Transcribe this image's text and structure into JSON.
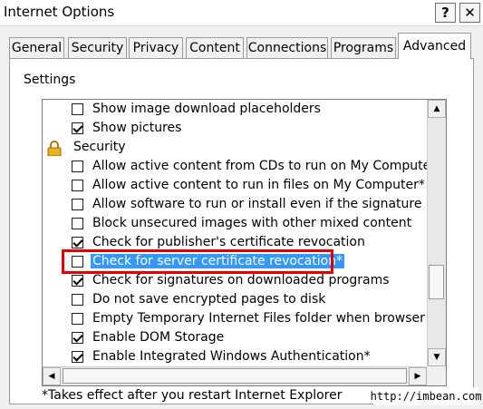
{
  "window": {
    "title": "Internet Options",
    "help_glyph": "?",
    "close_glyph": "✕"
  },
  "tabs": [
    {
      "label": "General"
    },
    {
      "label": "Security"
    },
    {
      "label": "Privacy"
    },
    {
      "label": "Content"
    },
    {
      "label": "Connections"
    },
    {
      "label": "Programs"
    },
    {
      "label": "Advanced",
      "active": true
    }
  ],
  "settings": {
    "label": "Settings",
    "group_label": "Security",
    "items": [
      {
        "label": "Show image download placeholders",
        "checked": false
      },
      {
        "label": "Show pictures",
        "checked": true
      },
      {
        "label": "Allow active content from CDs to run on My Computer*",
        "checked": false
      },
      {
        "label": "Allow active content to run in files on My Computer*",
        "checked": false
      },
      {
        "label": "Allow software to run or install even if the signature is inv",
        "checked": false
      },
      {
        "label": "Block unsecured images with other mixed content",
        "checked": false
      },
      {
        "label": "Check for publisher's certificate revocation",
        "checked": true
      },
      {
        "label": "Check for server certificate revocation*",
        "checked": false,
        "selected": true
      },
      {
        "label": "Check for signatures on downloaded programs",
        "checked": true
      },
      {
        "label": "Do not save encrypted pages to disk",
        "checked": false
      },
      {
        "label": "Empty Temporary Internet Files folder when browser is clo",
        "checked": false
      },
      {
        "label": "Enable DOM Storage",
        "checked": true
      },
      {
        "label": "Enable Integrated Windows Authentication*",
        "checked": true
      }
    ]
  },
  "footnote": "*Takes effect after you restart Internet Explorer",
  "watermark": "http://imbean.com",
  "colors": {
    "selection": "#3399ff",
    "annotation_box": "#e00000"
  },
  "icons": {
    "group": "lock-icon"
  }
}
